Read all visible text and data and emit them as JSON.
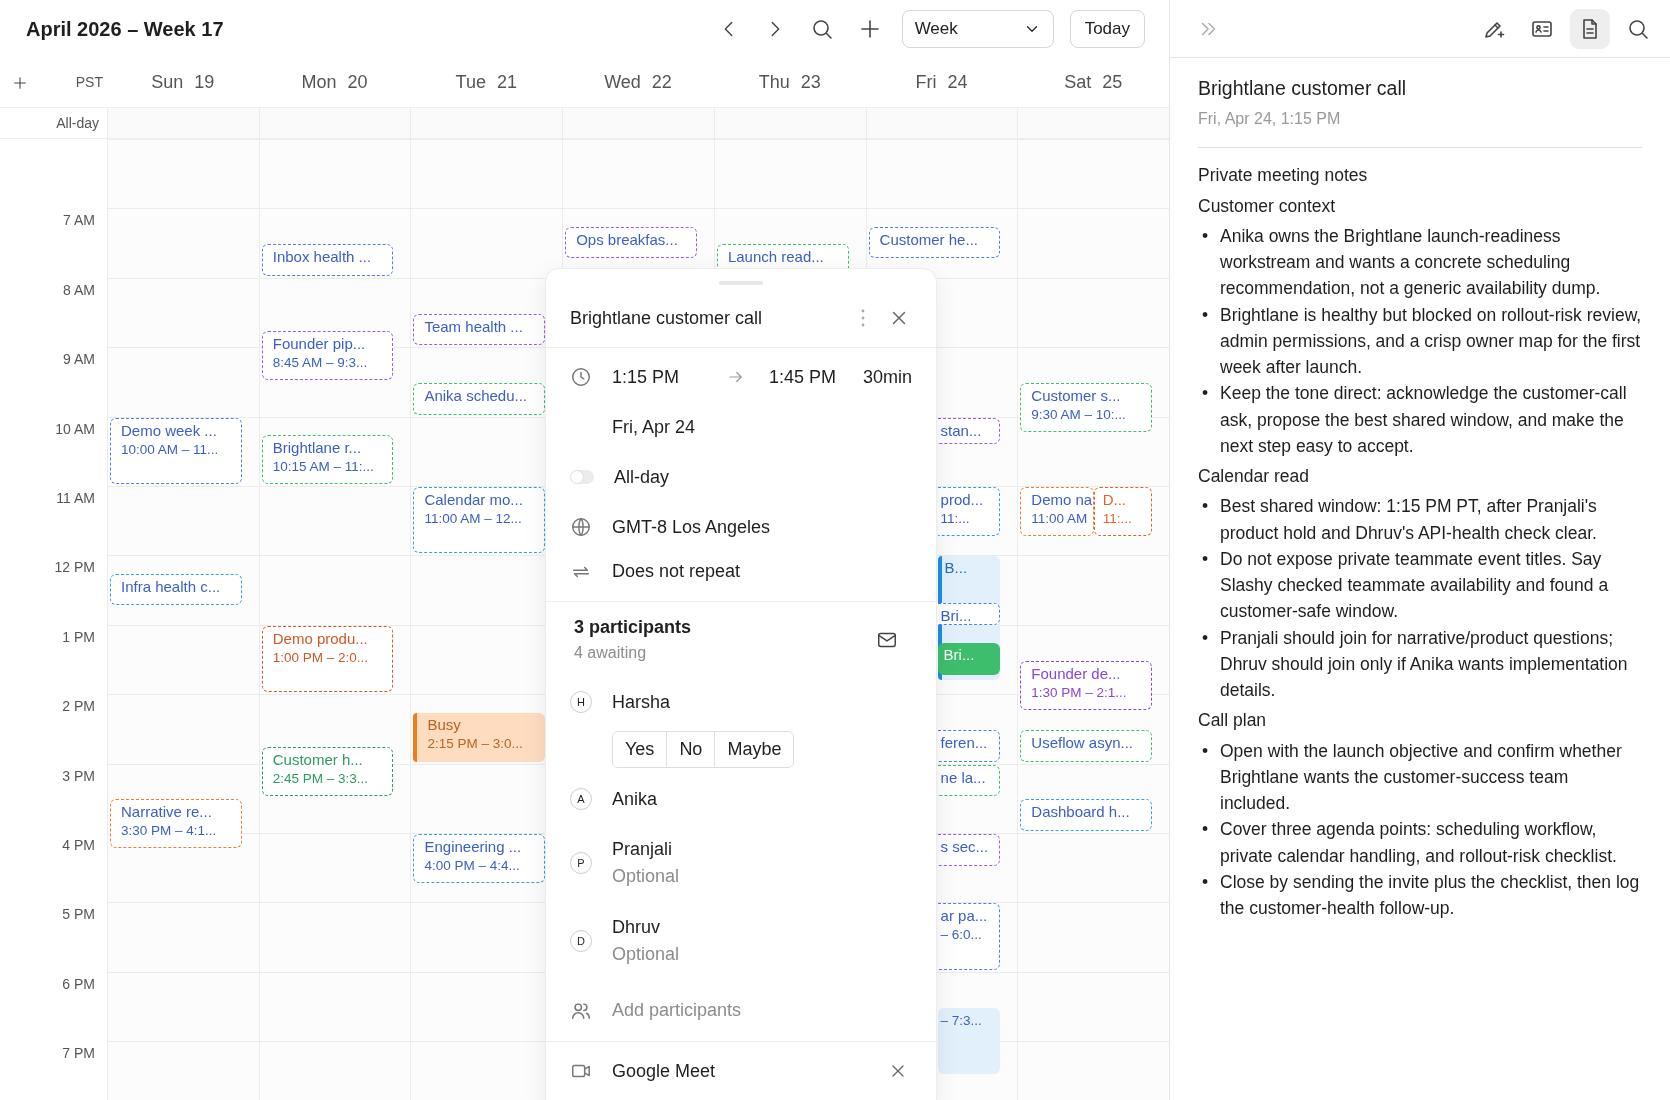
{
  "header": {
    "title": "April 2026 – Week 17",
    "view": "Week",
    "today": "Today"
  },
  "calendar": {
    "timezone": "PST",
    "all_day_label": "All-day",
    "hours": [
      "7 AM",
      "8 AM",
      "9 AM",
      "10 AM",
      "11 AM",
      "12 PM",
      "1 PM",
      "2 PM",
      "3 PM",
      "4 PM",
      "5 PM",
      "6 PM",
      "7 PM"
    ],
    "days": [
      {
        "label": "Sun 19",
        "events": [
          {
            "kind": "outline",
            "color": "#4f7fe6",
            "title": "Demo week ...",
            "time": "10:00 AM – 11..."
          },
          {
            "kind": "outline",
            "color": "#3a9fd9",
            "title": "Infra health c..."
          },
          {
            "kind": "outline",
            "color": "#f07a3a",
            "title": "Narrative re...",
            "time": "3:30 PM – 4:1..."
          }
        ]
      },
      {
        "label": "Mon 20",
        "events": [
          {
            "kind": "outline",
            "color": "#4f7fe6",
            "title": "Inbox health ..."
          },
          {
            "kind": "outline",
            "color": "#9b59e8",
            "title": "Founder pip...",
            "time": "8:45 AM – 9:3..."
          },
          {
            "kind": "outline",
            "color": "#3cbf6e",
            "title": "Brightlane r...",
            "time": "10:15 AM – 11:..."
          },
          {
            "kind": "tinted",
            "color": "#d0582a",
            "title": "Demo produ...",
            "time": "1:00 PM – 2:0..."
          },
          {
            "kind": "tinted",
            "color": "#2f9a5c",
            "title": "Customer h...",
            "time": "2:45 PM – 3:3..."
          }
        ]
      },
      {
        "label": "Tue 21",
        "events": [
          {
            "kind": "outline",
            "color": "#9b59e8",
            "title": "Team health ..."
          },
          {
            "kind": "outline",
            "color": "#3cbf6e",
            "title": "Anika schedu..."
          },
          {
            "kind": "outline",
            "color": "#3a9fd9",
            "title": "Calendar mo...",
            "time": "11:00 AM – 12..."
          },
          {
            "kind": "filled",
            "color": "#fddcc0",
            "title": "Busy",
            "time": "2:15 PM – 3:0..."
          },
          {
            "kind": "outline",
            "color": "#3a9fd9",
            "title": "Engineering ...",
            "time": "4:00 PM – 4:4..."
          }
        ]
      },
      {
        "label": "Wed 22",
        "events": [
          {
            "kind": "outline",
            "color": "#9b59e8",
            "title": "Ops breakfas..."
          }
        ]
      },
      {
        "label": "Thu 23",
        "events": [
          {
            "kind": "outline",
            "color": "#3cbf6e",
            "title": "Launch read..."
          }
        ]
      },
      {
        "label": "Fri 24",
        "events": [
          {
            "kind": "outline",
            "color": "#4f7fe6",
            "title": "Customer he..."
          },
          {
            "kind": "outline",
            "color": "#9b59e8",
            "title": "stan..."
          },
          {
            "kind": "outline",
            "color": "#3a9fd9",
            "title": "prod...",
            "time": "11:..."
          },
          {
            "kind": "filled",
            "color": "#e2f0fc",
            "title": "B..."
          },
          {
            "kind": "outline",
            "color": "#4f7fe6",
            "title": "Bri..."
          },
          {
            "kind": "solid",
            "color": "#3dbe6c",
            "title": "Bri..."
          },
          {
            "kind": "outline",
            "color": "#4f7fe6",
            "title": "feren..."
          },
          {
            "kind": "outline",
            "color": "#3cbf6e",
            "title": "ne la..."
          },
          {
            "kind": "outline",
            "color": "#9b59e8",
            "title": "s sec..."
          },
          {
            "kind": "outline",
            "color": "#4f7fe6",
            "title": "ar pa...",
            "time": "– 6:0..."
          },
          {
            "kind": "shaded",
            "color": "#e2f0fc",
            "time": "– 7:3..."
          }
        ]
      },
      {
        "label": "Sat 25",
        "events": [
          {
            "kind": "outline",
            "color": "#3cbf6e",
            "title": "Customer s...",
            "time": "9:30 AM – 10:..."
          },
          {
            "kind": "outline",
            "color": "#f07a3a",
            "title": "Demo na",
            "time": "11:00 AM"
          },
          {
            "kind": "tinted",
            "color": "#e0642e",
            "title": "D...",
            "time": "11:..."
          },
          {
            "kind": "tinted",
            "color": "#8a46d6",
            "title": "Founder de...",
            "time": "1:30 PM – 2:1..."
          },
          {
            "kind": "outline",
            "color": "#3cbf6e",
            "title": "Useflow asyn..."
          },
          {
            "kind": "outline",
            "color": "#3a9fd9",
            "title": "Dashboard h..."
          }
        ]
      }
    ]
  },
  "event_popup": {
    "title": "Brightlane customer call",
    "start": "1:15 PM",
    "end": "1:45 PM",
    "duration": "30min",
    "date": "Fri, Apr 24",
    "all_day": {
      "label": "All-day",
      "on": false
    },
    "timezone": "GMT-8 Los Angeles",
    "repeat": "Does not repeat",
    "participants_count": "3 participants",
    "awaiting": "4 awaiting",
    "participants": [
      {
        "initial": "H",
        "name": "Harsha",
        "rsvp": [
          {
            "label": "Yes",
            "selected": false
          },
          {
            "label": "No",
            "selected": false
          },
          {
            "label": "Maybe",
            "selected": false
          }
        ]
      },
      {
        "initial": "A",
        "name": "Anika"
      },
      {
        "initial": "P",
        "name": "Pranjali",
        "note": "Optional"
      },
      {
        "initial": "D",
        "name": "Dhruv",
        "note": "Optional"
      }
    ],
    "add_participants": "Add participants",
    "conferencing": "Google Meet"
  },
  "notes_panel": {
    "tools": [
      {
        "kind": "compose",
        "selected": false
      },
      {
        "kind": "contact",
        "selected": false
      },
      {
        "kind": "document",
        "selected": true
      },
      {
        "kind": "search",
        "selected": false
      }
    ],
    "title": "Brightlane customer call",
    "subtitle": "Fri, Apr 24, 1:15 PM",
    "lead": "Private meeting notes",
    "sections": [
      {
        "heading": "Customer context",
        "items": [
          {
            "bullet": "•",
            "text": "Anika owns the Brightlane launch-readiness workstream and wants a concrete scheduling recommendation, not a generic availability dump."
          },
          {
            "bullet": "•",
            "text": "Brightlane is healthy but blocked on rollout-risk review, admin permissions, and a crisp owner map for the first week after launch."
          },
          {
            "bullet": "•",
            "text": "Keep the tone direct: acknowledge the customer-call ask, propose the best shared window, and make the next step easy to accept."
          }
        ]
      },
      {
        "heading": "Calendar read",
        "items": [
          {
            "bullet": "•",
            "text": "Best shared window: 1:15 PM PT, after Pranjali's product hold and Dhruv's API-health check clear."
          },
          {
            "bullet": "•",
            "text": "Do not expose private teammate event titles. Say Slashy checked teammate availability and found a customer-safe window."
          },
          {
            "bullet": "•",
            "text": "Pranjali should join for narrative/product questions; Dhruv should join only if Anika wants implementation details."
          }
        ]
      },
      {
        "heading": "Call plan",
        "items": [
          {
            "bullet": "•",
            "text": "Open with the launch objective and confirm whether Brightlane wants the customer-success team included."
          },
          {
            "bullet": "•",
            "text": "Cover three agenda points: scheduling workflow, private calendar handling, and rollout-risk checklist."
          },
          {
            "bullet": "•",
            "text": "Close by sending the invite plus the checklist, then log the customer-health follow-up."
          }
        ]
      }
    ]
  }
}
